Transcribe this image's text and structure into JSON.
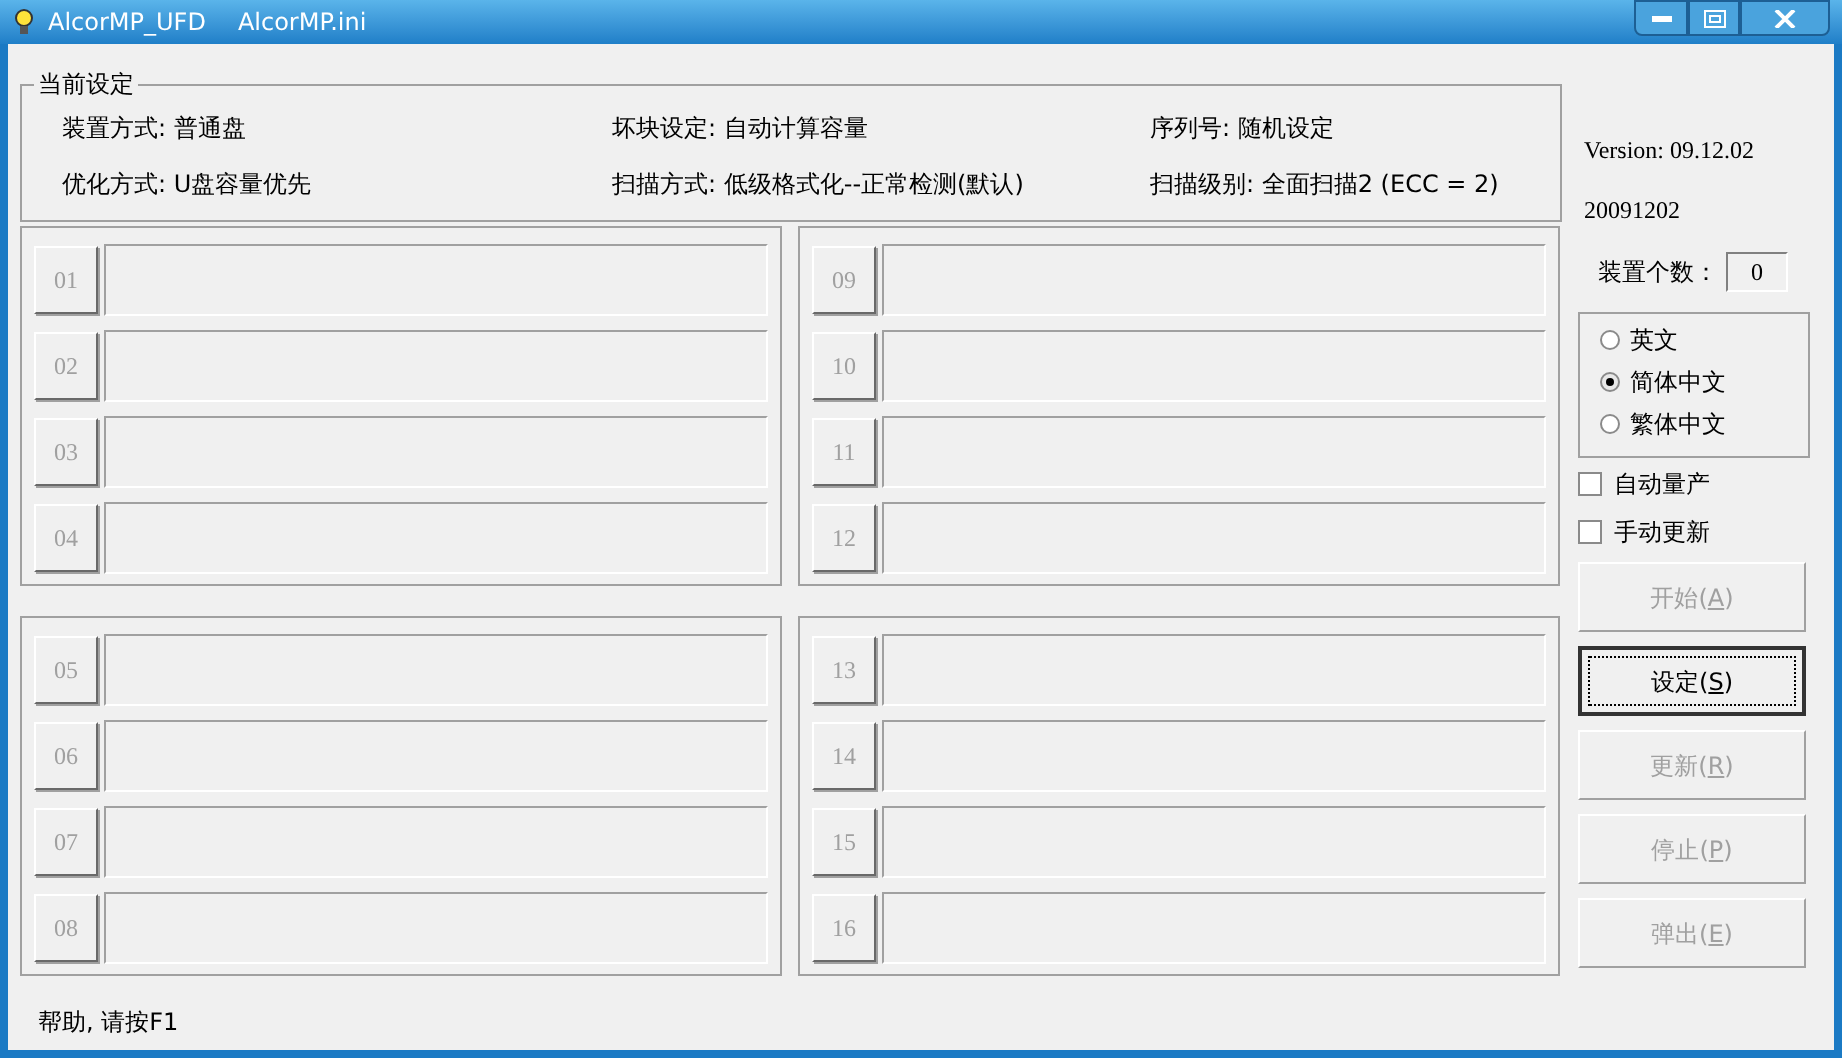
{
  "window": {
    "title": "AlcorMP_UFD",
    "subtitle": "AlcorMP.ini"
  },
  "settings": {
    "title": "当前设定",
    "items": [
      "装置方式: 普通盘",
      "坏块设定: 自动计算容量",
      "序列号: 随机设定",
      "优化方式: U盘容量优先",
      "扫描方式: 低级格式化--正常检测(默认)",
      "扫描级别: 全面扫描2 (ECC = 2)"
    ]
  },
  "port_groups": [
    {
      "ports": [
        {
          "label": "01"
        },
        {
          "label": "02"
        },
        {
          "label": "03"
        },
        {
          "label": "04"
        }
      ]
    },
    {
      "ports": [
        {
          "label": "09"
        },
        {
          "label": "10"
        },
        {
          "label": "11"
        },
        {
          "label": "12"
        }
      ]
    },
    {
      "ports": [
        {
          "label": "05"
        },
        {
          "label": "06"
        },
        {
          "label": "07"
        },
        {
          "label": "08"
        }
      ]
    },
    {
      "ports": [
        {
          "label": "13"
        },
        {
          "label": "14"
        },
        {
          "label": "15"
        },
        {
          "label": "16"
        }
      ]
    }
  ],
  "side": {
    "version": "Version: 09.12.02",
    "build": "20091202",
    "device_count_label": "装置个数：",
    "device_count": "0",
    "languages": [
      {
        "label": "英文",
        "selected": false
      },
      {
        "label": "简体中文",
        "selected": true
      },
      {
        "label": "繁体中文",
        "selected": false
      }
    ],
    "options": [
      {
        "label": "自动量产",
        "checked": false
      },
      {
        "label": "手动更新",
        "checked": false
      }
    ],
    "buttons": [
      {
        "before": "开始(",
        "key": "A",
        "after": ")",
        "disabled": true,
        "focused": false
      },
      {
        "before": "设定(",
        "key": "S",
        "after": ")",
        "disabled": false,
        "focused": true
      },
      {
        "before": "更新(",
        "key": "R",
        "after": ")",
        "disabled": true,
        "focused": false
      },
      {
        "before": "停止(",
        "key": "P",
        "after": ")",
        "disabled": true,
        "focused": false
      },
      {
        "before": "弹出(",
        "key": "E",
        "after": ")",
        "disabled": true,
        "focused": false
      }
    ]
  },
  "status_bar": "帮助, 请按F1"
}
